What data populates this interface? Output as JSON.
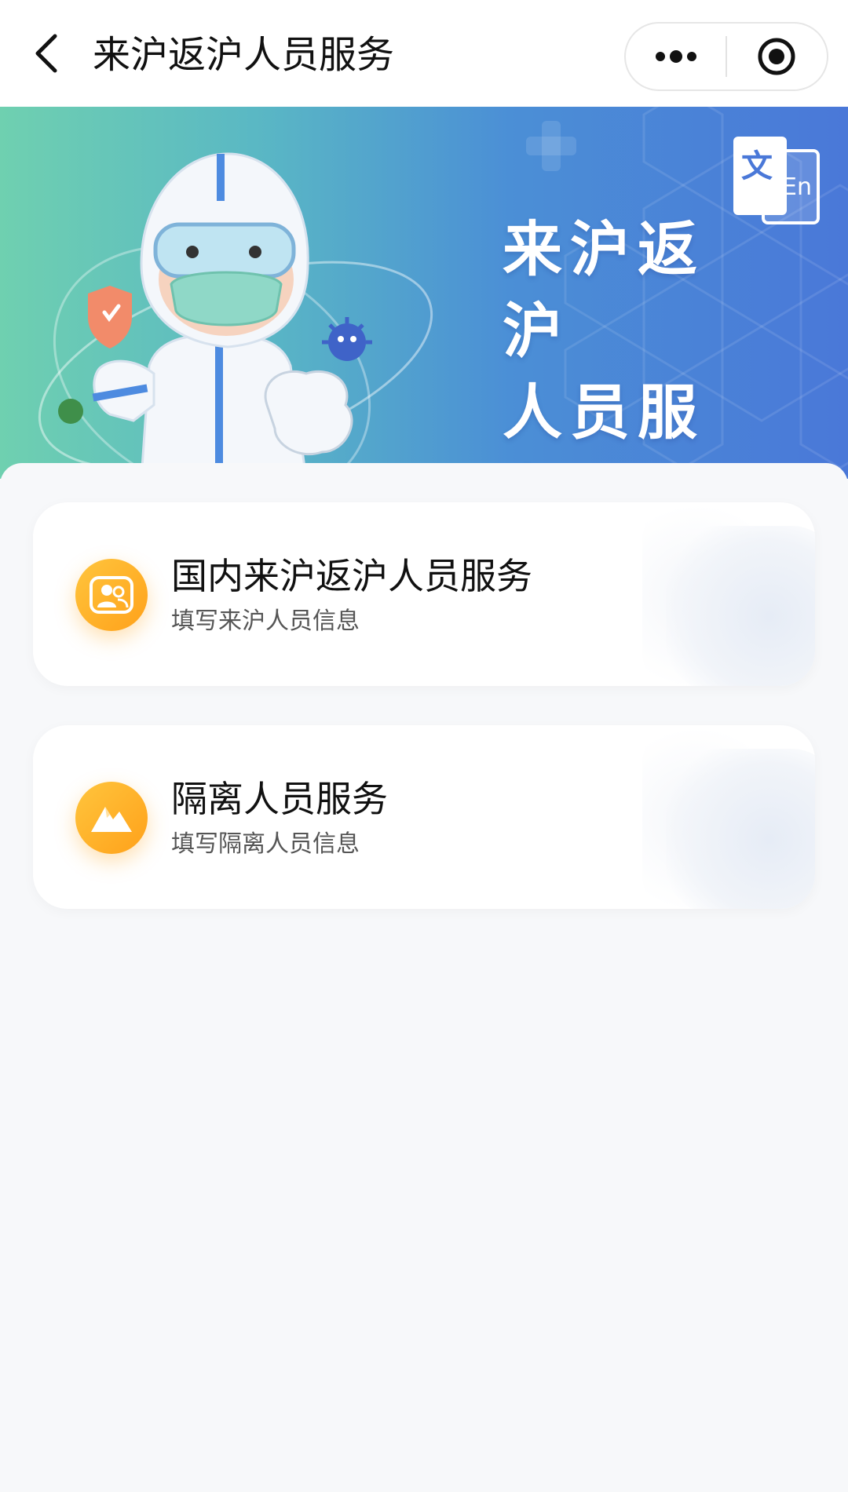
{
  "navbar": {
    "title": "来沪返沪人员服务",
    "back_icon": "chevron-left-icon",
    "more_icon": "more-dots-icon",
    "close_icon": "target-circle-icon"
  },
  "banner": {
    "title_line1": "来沪返沪",
    "title_line2": "人员服务",
    "lang_switch": {
      "cn_char": "文",
      "en_label": "En"
    }
  },
  "services": [
    {
      "title": "国内来沪返沪人员服务",
      "subtitle": "填写来沪人员信息",
      "icon": "people-icon"
    },
    {
      "title": "隔离人员服务",
      "subtitle": "填写隔离人员信息",
      "icon": "mountain-icon"
    }
  ],
  "colors": {
    "icon_orange": "#ffa11a",
    "banner_left": "#6fd0b0",
    "banner_right": "#4a78d8",
    "background": "#f7f8fa"
  }
}
